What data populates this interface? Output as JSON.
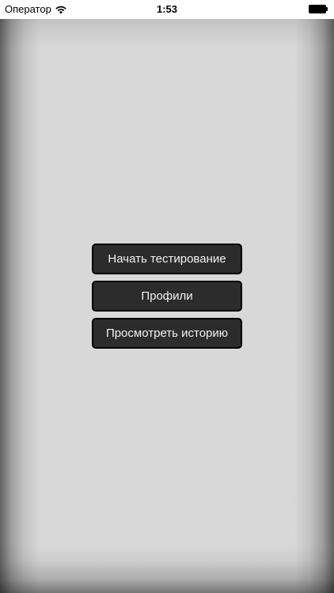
{
  "status_bar": {
    "carrier": "Оператор",
    "time": "1:53",
    "icons": [
      "wifi-icon",
      "battery-icon"
    ]
  },
  "colors": {
    "background": "#d8d8d8",
    "button_background": "#2c2c2c",
    "button_border": "#000000",
    "button_text": "#f2f2f2"
  },
  "menu": {
    "buttons": [
      {
        "label": "Начать тестирование"
      },
      {
        "label": "Профили"
      },
      {
        "label": "Просмотреть историю"
      }
    ]
  }
}
